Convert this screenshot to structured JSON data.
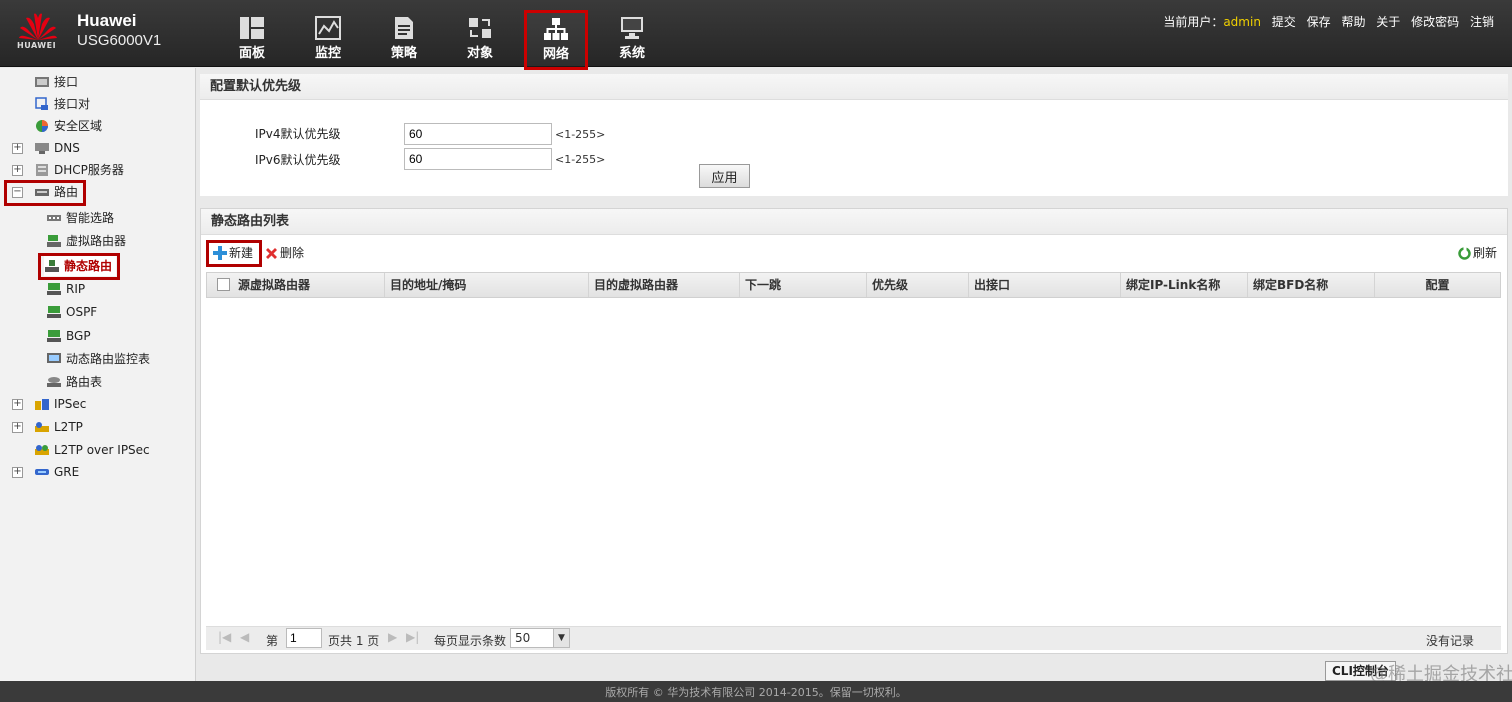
{
  "header": {
    "brand_name": "Huawei",
    "model": "USG6000V1",
    "logo_text": "HUAWEI",
    "nav": [
      {
        "label": "面板",
        "icon": "dashboard-icon"
      },
      {
        "label": "监控",
        "icon": "monitor-chart-icon"
      },
      {
        "label": "策略",
        "icon": "policy-document-icon"
      },
      {
        "label": "对象",
        "icon": "object-icon"
      },
      {
        "label": "网络",
        "icon": "network-tree-icon",
        "active": true
      },
      {
        "label": "系统",
        "icon": "system-computer-icon"
      }
    ],
    "user_label": "当前用户：",
    "username": "admin",
    "links": [
      "提交",
      "保存",
      "帮助",
      "关于",
      "修改密码",
      "注销"
    ]
  },
  "sidebar": {
    "items": [
      {
        "label": "接口",
        "icon": "interface-icon"
      },
      {
        "label": "接口对",
        "icon": "interface-pair-icon"
      },
      {
        "label": "安全区域",
        "icon": "security-zone-icon"
      },
      {
        "label": "DNS",
        "icon": "dns-icon",
        "expandable": true
      },
      {
        "label": "DHCP服务器",
        "icon": "dhcp-server-icon",
        "expandable": true
      },
      {
        "label": "路由",
        "icon": "router-icon",
        "expandable": true,
        "expanded": true
      },
      {
        "label": "智能选路",
        "icon": "smart-route-icon",
        "child": true
      },
      {
        "label": "虚拟路由器",
        "icon": "virtual-router-icon",
        "child": true
      },
      {
        "label": "静态路由",
        "icon": "static-route-icon",
        "child": true,
        "selected": true
      },
      {
        "label": "RIP",
        "icon": "rip-icon",
        "child": true
      },
      {
        "label": "OSPF",
        "icon": "ospf-icon",
        "child": true
      },
      {
        "label": "BGP",
        "icon": "bgp-icon",
        "child": true
      },
      {
        "label": "动态路由监控表",
        "icon": "route-monitor-icon",
        "child": true
      },
      {
        "label": "路由表",
        "icon": "route-table-icon",
        "child": true
      },
      {
        "label": "IPSec",
        "icon": "ipsec-icon",
        "expandable": true
      },
      {
        "label": "L2TP",
        "icon": "l2tp-icon",
        "expandable": true
      },
      {
        "label": "L2TP over IPSec",
        "icon": "l2tp-over-ipsec-icon"
      },
      {
        "label": "GRE",
        "icon": "gre-icon",
        "expandable": true
      }
    ]
  },
  "priority_panel": {
    "title": "配置默认优先级",
    "ipv4_label": "IPv4默认优先级",
    "ipv4_value": "60",
    "ipv6_label": "IPv6默认优先级",
    "ipv6_value": "60",
    "range_hint": "<1-255>",
    "apply_label": "应用"
  },
  "route_list": {
    "title": "静态路由列表",
    "new_label": "新建",
    "delete_label": "删除",
    "refresh_label": "刷新",
    "columns": [
      "源虚拟路由器",
      "目的地址/掩码",
      "目的虚拟路由器",
      "下一跳",
      "优先级",
      "出接口",
      "绑定IP-Link名称",
      "绑定BFD名称",
      "配置"
    ],
    "rows": []
  },
  "pager": {
    "page_prefix": "第",
    "page_value": "1",
    "page_suffix": "页共 1 页",
    "per_page_label": "每页显示条数",
    "per_page_value": "50",
    "no_records": "没有记录"
  },
  "footer": {
    "copyright": "版权所有 © 华为技术有限公司 2014-2015。保留一切权利。",
    "cli_label": "CLI控制台",
    "watermark": "@稀土掘金技术社区"
  },
  "colors": {
    "highlight_red": "#b00000",
    "username_yellow": "#f0d000",
    "header_bg": "#2e2e2e"
  }
}
